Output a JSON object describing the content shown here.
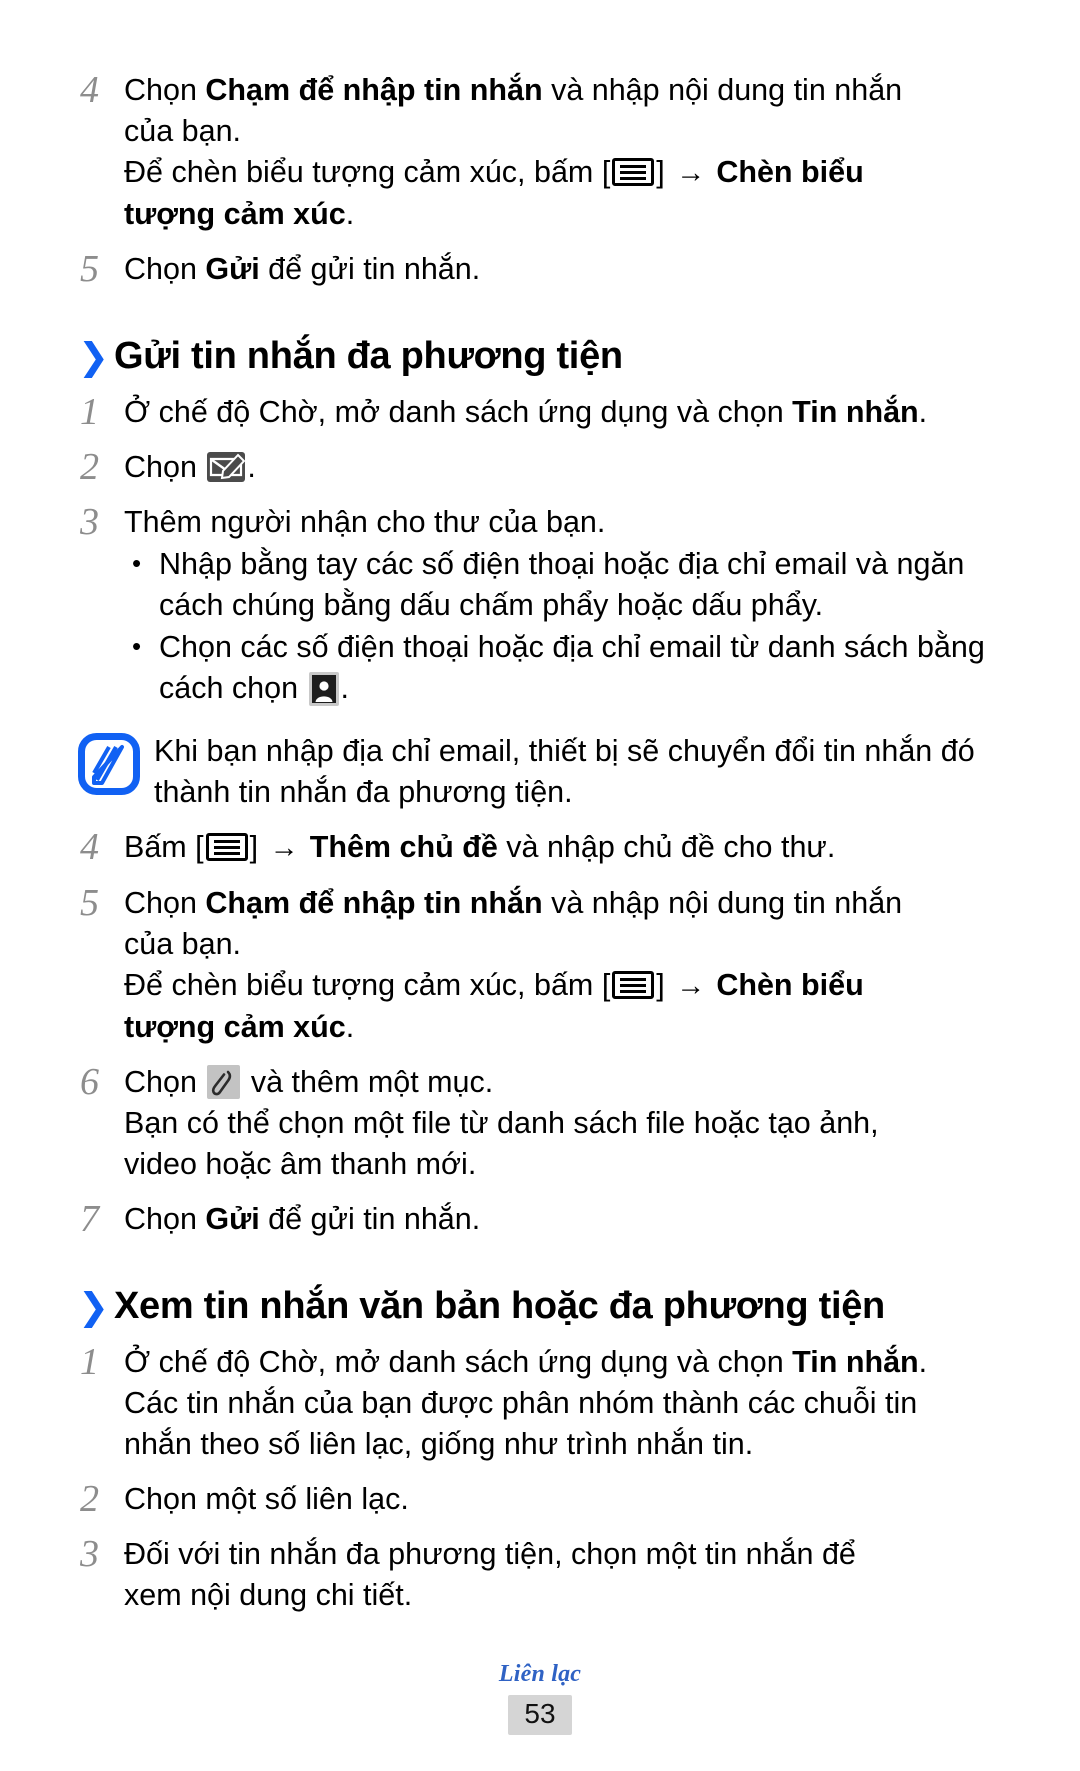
{
  "document": {
    "language": "vi",
    "page_number": "53",
    "footer_label": "Liên lạc"
  },
  "colors": {
    "accent_blue": "#1161f3",
    "footer_blue": "#2f62c4",
    "step_number_gray": "#8d8d8d",
    "page_box_gray": "#d5d5d5"
  },
  "top_steps": [
    {
      "number": "4",
      "lines": [
        {
          "parts": [
            {
              "t": "Chọn ",
              "bold": false
            },
            {
              "t": "Chạm để nhập tin nhắn",
              "bold": true
            },
            {
              "t": " và nhập nội dung tin nhắn",
              "bold": false
            }
          ]
        },
        {
          "parts": [
            {
              "t": "của bạn.",
              "bold": false
            }
          ]
        }
      ],
      "sub_lines": [
        {
          "parts": [
            {
              "t": "Để chèn biểu tượng cảm xúc, bấm [",
              "bold": false
            },
            {
              "icon": "menu-key-icon"
            },
            {
              "t": "] ",
              "bold": false
            },
            {
              "t": "→ ",
              "arrow": true
            },
            {
              "t": "Chèn biểu",
              "bold": true
            }
          ]
        },
        {
          "parts": [
            {
              "t": "tượng cảm xúc",
              "bold": true
            },
            {
              "t": ".",
              "bold": false
            }
          ]
        }
      ]
    },
    {
      "number": "5",
      "lines": [
        {
          "parts": [
            {
              "t": "Chọn ",
              "bold": false
            },
            {
              "t": "Gửi",
              "bold": true
            },
            {
              "t": " để gửi tin nhắn.",
              "bold": false
            }
          ]
        }
      ],
      "sub_lines": []
    }
  ],
  "section_mms": {
    "chevron": "❯",
    "title": "Gửi tin nhắn đa phương tiện",
    "steps": [
      {
        "number": "1",
        "lines": [
          {
            "parts": [
              {
                "t": "Ở chế độ Chờ, mở danh sách ứng dụng và chọn ",
                "bold": false
              },
              {
                "t": "Tin nhắn",
                "bold": true
              },
              {
                "t": ".",
                "bold": false
              }
            ]
          }
        ]
      },
      {
        "number": "2",
        "lines": [
          {
            "parts": [
              {
                "t": "Chọn ",
                "bold": false
              },
              {
                "icon": "compose-message-icon"
              },
              {
                "t": ".",
                "bold": false
              }
            ]
          }
        ]
      },
      {
        "number": "3",
        "lines": [
          {
            "parts": [
              {
                "t": "Thêm người nhận cho thư của bạn.",
                "bold": false
              }
            ]
          }
        ],
        "bullets": [
          [
            {
              "t": "Nhập bằng tay các số điện thoại hoặc địa chỉ email và ngăn cách chúng bằng dấu chấm phẩy hoặc dấu phẩy.",
              "bold": false
            }
          ],
          [
            {
              "t": "Chọn các số điện thoại hoặc địa chỉ email từ danh sách bằng cách chọn ",
              "bold": false
            },
            {
              "icon": "contact-picker-icon"
            },
            {
              "t": ".",
              "bold": false
            }
          ]
        ]
      },
      {
        "number": "4",
        "lines": [
          {
            "parts": [
              {
                "t": "Bấm [",
                "bold": false
              },
              {
                "icon": "menu-key-icon"
              },
              {
                "t": "] ",
                "bold": false
              },
              {
                "t": "→ ",
                "arrow": true
              },
              {
                "t": "Thêm chủ đề",
                "bold": true
              },
              {
                "t": " và nhập chủ đề cho thư.",
                "bold": false
              }
            ]
          }
        ]
      },
      {
        "number": "5",
        "lines": [
          {
            "parts": [
              {
                "t": "Chọn ",
                "bold": false
              },
              {
                "t": "Chạm để nhập tin nhắn",
                "bold": true
              },
              {
                "t": " và nhập nội dung tin nhắn",
                "bold": false
              }
            ]
          },
          {
            "parts": [
              {
                "t": "của bạn.",
                "bold": false
              }
            ]
          }
        ],
        "sub_lines": [
          {
            "parts": [
              {
                "t": "Để chèn biểu tượng cảm xúc, bấm [",
                "bold": false
              },
              {
                "icon": "menu-key-icon"
              },
              {
                "t": "] ",
                "bold": false
              },
              {
                "t": "→ ",
                "arrow": true
              },
              {
                "t": "Chèn biểu",
                "bold": true
              }
            ]
          },
          {
            "parts": [
              {
                "t": "tượng cảm xúc",
                "bold": true
              },
              {
                "t": ".",
                "bold": false
              }
            ]
          }
        ]
      },
      {
        "number": "6",
        "lines": [
          {
            "parts": [
              {
                "t": "Chọn ",
                "bold": false
              },
              {
                "icon": "attach-icon"
              },
              {
                "t": " và thêm một mục.",
                "bold": false
              }
            ]
          },
          {
            "parts": [
              {
                "t": "Bạn có thể chọn một file từ danh sách file hoặc tạo ảnh,",
                "bold": false
              }
            ]
          },
          {
            "parts": [
              {
                "t": "video hoặc âm thanh mới.",
                "bold": false
              }
            ]
          }
        ]
      },
      {
        "number": "7",
        "lines": [
          {
            "parts": [
              {
                "t": "Chọn ",
                "bold": false
              },
              {
                "t": "Gửi",
                "bold": true
              },
              {
                "t": " để gửi tin nhắn.",
                "bold": false
              }
            ]
          }
        ]
      }
    ]
  },
  "note": {
    "icon": "note-pencil-icon",
    "text": "Khi bạn nhập địa chỉ email, thiết bị sẽ chuyển đổi tin nhắn đó thành tin nhắn đa phương tiện."
  },
  "section_view": {
    "chevron": "❯",
    "title": "Xem tin nhắn văn bản hoặc đa phương tiện",
    "steps": [
      {
        "number": "1",
        "lines": [
          {
            "parts": [
              {
                "t": "Ở chế độ Chờ, mở danh sách ứng dụng và chọn ",
                "bold": false
              },
              {
                "t": "Tin nhắn",
                "bold": true
              },
              {
                "t": ".",
                "bold": false
              }
            ]
          },
          {
            "parts": [
              {
                "t": "Các tin nhắn của bạn được phân nhóm thành các chuỗi tin",
                "bold": false
              }
            ]
          },
          {
            "parts": [
              {
                "t": "nhắn theo số liên lạc, giống như trình nhắn tin.",
                "bold": false
              }
            ]
          }
        ]
      },
      {
        "number": "2",
        "lines": [
          {
            "parts": [
              {
                "t": "Chọn một số liên lạc.",
                "bold": false
              }
            ]
          }
        ]
      },
      {
        "number": "3",
        "lines": [
          {
            "parts": [
              {
                "t": "Đối với tin nhắn đa phương tiện, chọn một tin nhắn để",
                "bold": false
              }
            ]
          },
          {
            "parts": [
              {
                "t": "xem nội dung chi tiết.",
                "bold": false
              }
            ]
          }
        ]
      }
    ]
  }
}
